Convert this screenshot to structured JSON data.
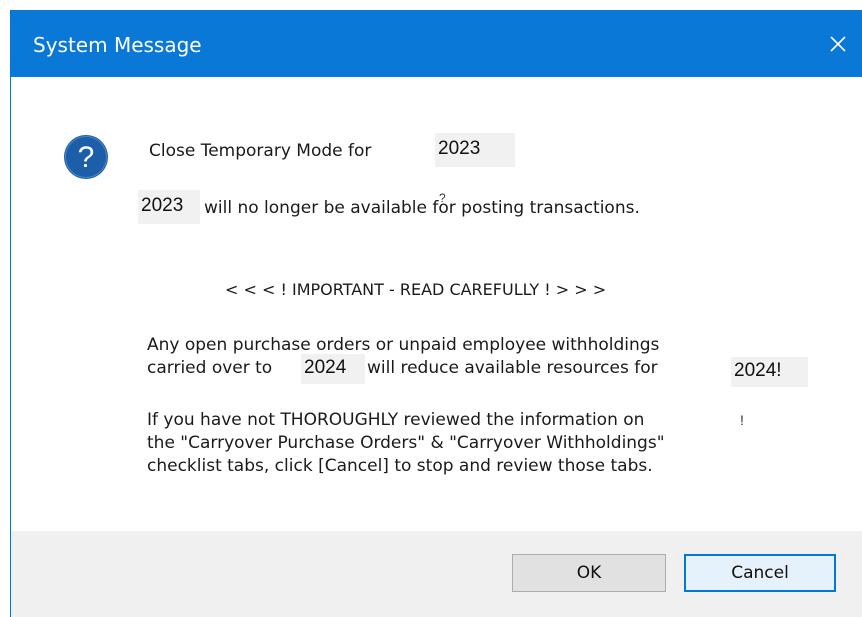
{
  "window": {
    "title": "System Message"
  },
  "message": {
    "line1_prefix": "Close Temporary Mode for",
    "year_current_a": "2023",
    "year_current_b": "2023",
    "line2_suffix": "will no longer be available for posting transactions.",
    "important_banner": "< < < ! IMPORTANT - READ CAREFULLY ! > > >",
    "para1_line1": "Any open purchase orders or unpaid employee withholdings",
    "para1_line2_prefix": "carried over to",
    "year_next_a": "2024",
    "para1_line2_middle": "will reduce available resources for",
    "year_next_b": "2024!",
    "para2_line1": "If you have not THOROUGHLY reviewed the information on",
    "para2_line2": "the \"Carryover Purchase Orders\" & \"Carryover Withholdings\"",
    "para2_line3": "checklist tabs, click [Cancel] to stop and review those tabs.",
    "stray_glyph_1": "?",
    "stray_glyph_2": "!"
  },
  "buttons": {
    "ok_label": "OK",
    "cancel_label": "Cancel"
  },
  "icons": {
    "question": "question-icon",
    "close": "close-icon"
  },
  "colors": {
    "titlebar": "#0a78d7",
    "question_icon": "#1d5ea8",
    "footer": "#f0f0f0",
    "default_button_border": "#0078d7"
  }
}
